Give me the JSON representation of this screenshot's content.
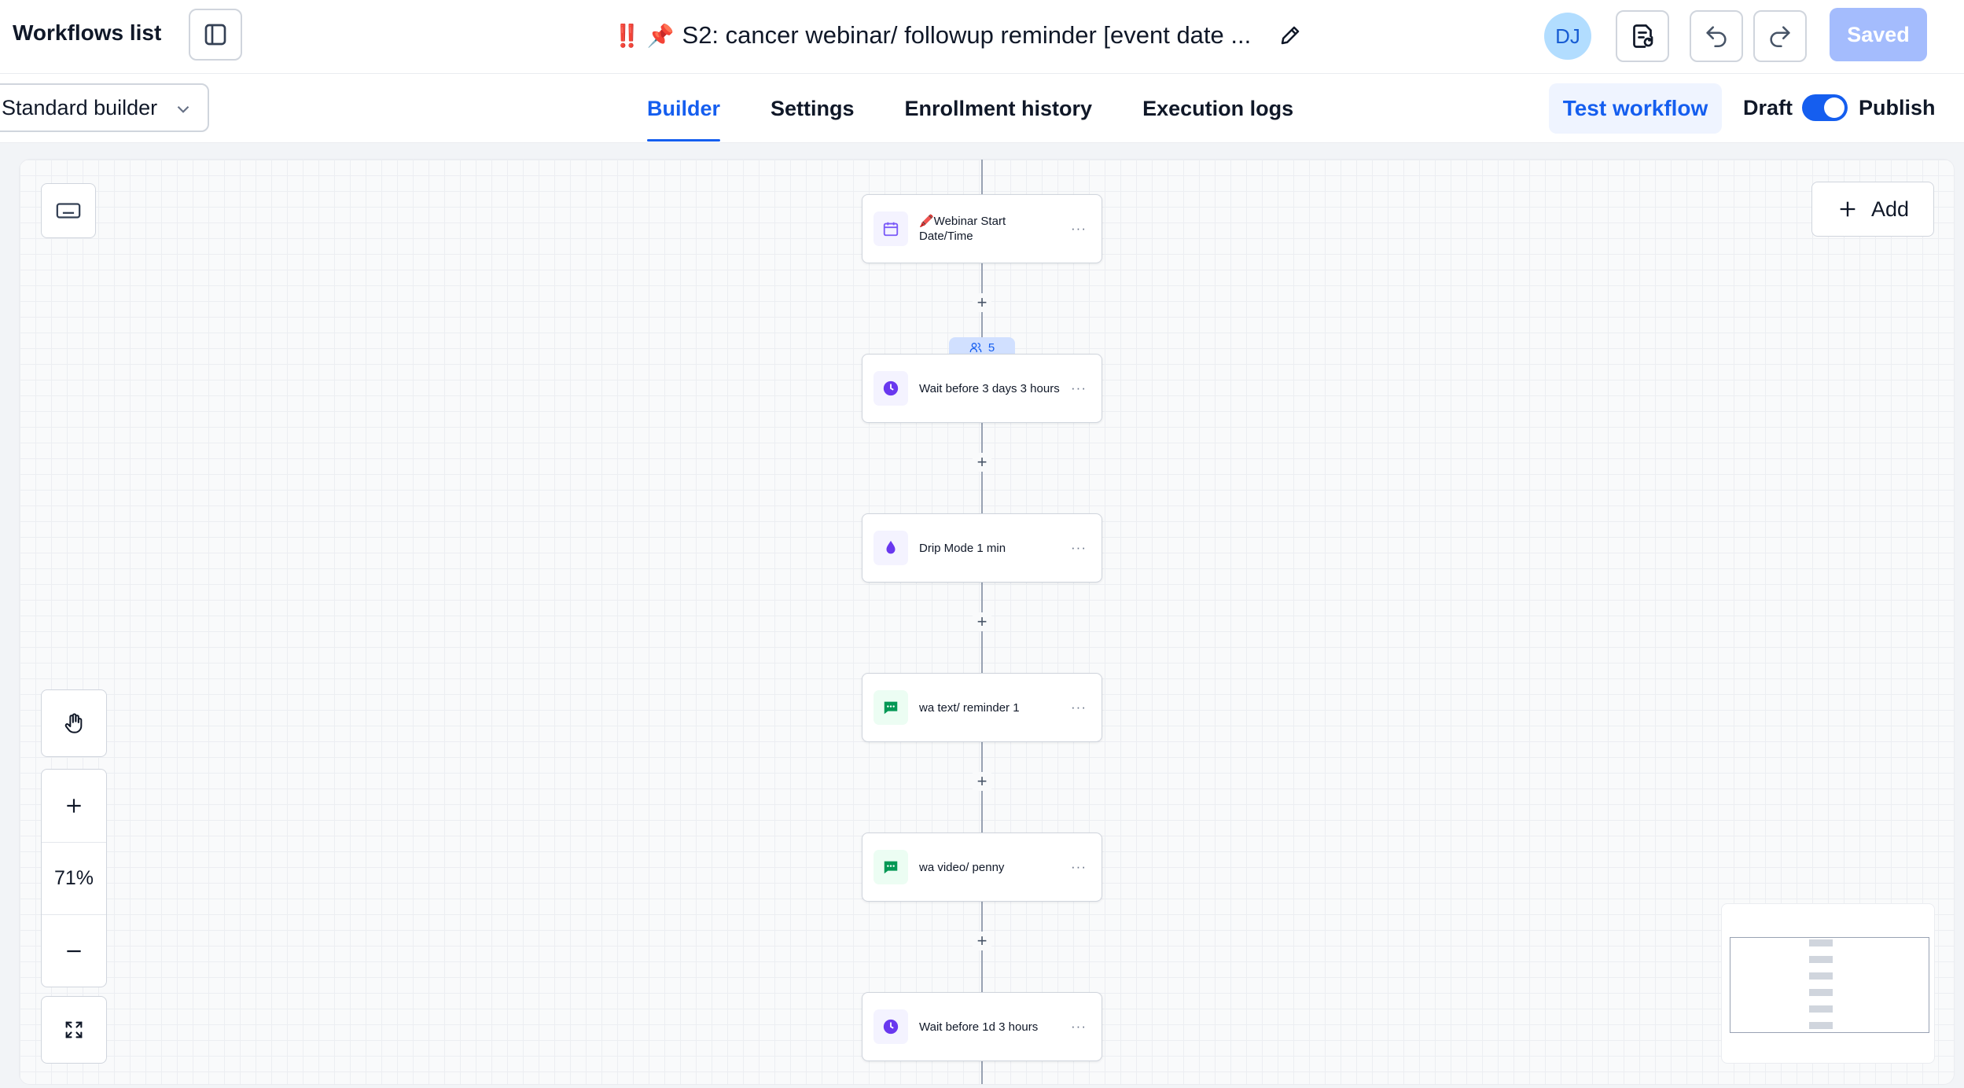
{
  "header": {
    "workflows_list": "Workflows list",
    "title_icons": "‼️ 📌",
    "title": "S2: cancer webinar/ followup reminder [event date ...",
    "avatar_initials": "DJ",
    "saved_label": "Saved"
  },
  "subbar": {
    "builder_select": "Standard builder",
    "tabs": [
      {
        "label": "Builder",
        "active": true
      },
      {
        "label": "Settings",
        "active": false
      },
      {
        "label": "Enrollment history",
        "active": false
      },
      {
        "label": "Execution logs",
        "active": false
      }
    ],
    "test_workflow": "Test workflow",
    "draft_label": "Draft",
    "publish_label": "Publish",
    "publish_toggle_on": true
  },
  "canvas": {
    "add_label": "Add",
    "zoom_level": "71%",
    "enrollment_count": "5",
    "nodes": [
      {
        "label": "🖍️Webinar Start Date/Time",
        "icon": "calendar-icon",
        "color": "#7a5af8"
      },
      {
        "label": "Wait before 3 days 3 hours",
        "icon": "clock-icon",
        "color": "#6938ef"
      },
      {
        "label": "Drip Mode 1 min",
        "icon": "drop-icon",
        "color": "#6938ef"
      },
      {
        "label": "wa text/ reminder 1",
        "icon": "chat-icon",
        "color": "#039855"
      },
      {
        "label": "wa video/ penny",
        "icon": "chat-icon",
        "color": "#039855"
      },
      {
        "label": "Wait before 1d 3 hours",
        "icon": "clock-icon",
        "color": "#6938ef"
      }
    ],
    "node_menu": "···",
    "plus_symbol": "+"
  },
  "colors": {
    "accent": "#155eef",
    "saved_button": "#a4bcfd",
    "avatar_bg": "#b2ddff"
  }
}
